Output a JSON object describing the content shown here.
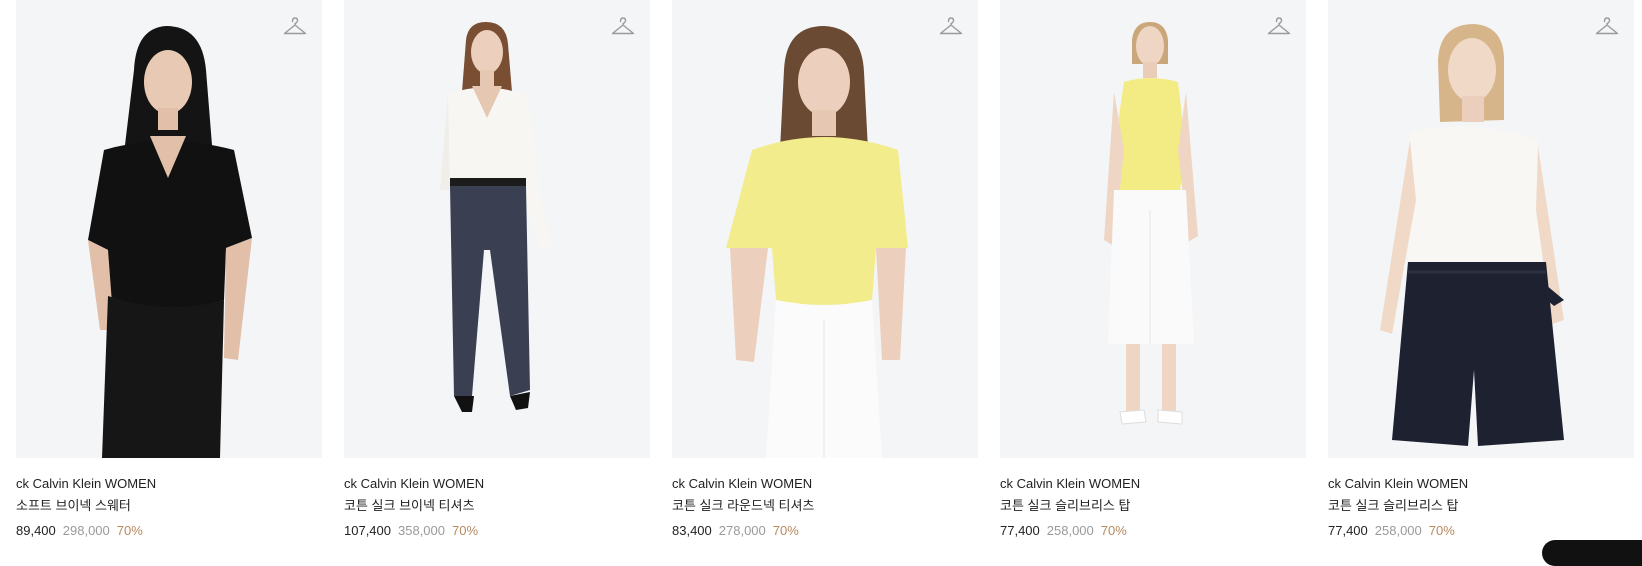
{
  "products": [
    {
      "brand": "ck Calvin Klein WOMEN",
      "name": "소프트 브이넥 스웨터",
      "price": "89,400",
      "original_price": "298,000",
      "discount": "70%",
      "image_icon": "woman-black-vneck-sweater"
    },
    {
      "brand": "ck Calvin Klein WOMEN",
      "name": "코튼 실크 브이넥 티셔츠",
      "price": "107,400",
      "original_price": "358,000",
      "discount": "70%",
      "image_icon": "woman-white-vneck-tshirt"
    },
    {
      "brand": "ck Calvin Klein WOMEN",
      "name": "코튼 실크 라운드넥 티셔츠",
      "price": "83,400",
      "original_price": "278,000",
      "discount": "70%",
      "image_icon": "woman-yellow-roundneck-tshirt"
    },
    {
      "brand": "ck Calvin Klein WOMEN",
      "name": "코튼 실크 슬리브리스 탑",
      "price": "77,400",
      "original_price": "258,000",
      "discount": "70%",
      "image_icon": "woman-yellow-sleeveless-top"
    },
    {
      "brand": "ck Calvin Klein WOMEN",
      "name": "코튼 실크 슬리브리스 탑",
      "price": "77,400",
      "original_price": "258,000",
      "discount": "70%",
      "image_icon": "woman-white-sleeveless-top"
    }
  ],
  "icons": {
    "wishlist": "hanger-icon"
  },
  "colors": {
    "image_background": "#f4f5f7",
    "text": "#222222",
    "original_price": "#9a9a9a",
    "discount": "#b68a5e"
  }
}
